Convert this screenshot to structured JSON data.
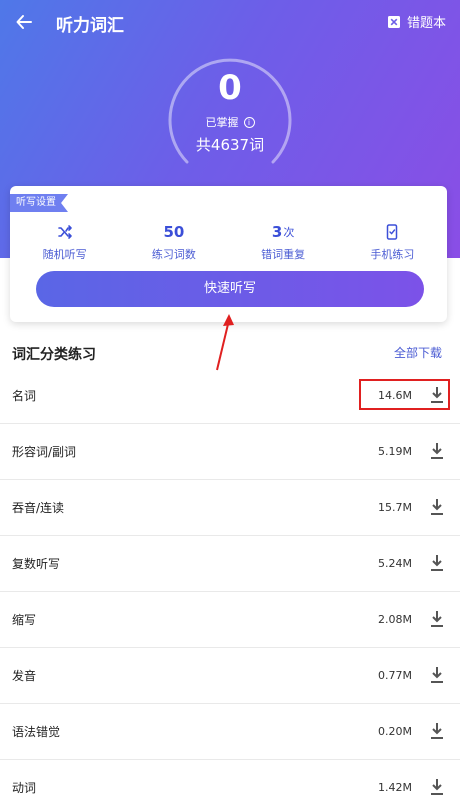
{
  "header": {
    "title": "听力词汇",
    "mistake_book_label": "错题本",
    "mastered_count": "0",
    "mastered_label": "已掌握",
    "total_label": "共4637词"
  },
  "settings_card": {
    "tag": "听写设置",
    "items": [
      {
        "value": "",
        "unit": "",
        "icon": "shuffle-icon",
        "label": "随机听写"
      },
      {
        "value": "50",
        "unit": "",
        "icon": "",
        "label": "练习词数"
      },
      {
        "value": "3",
        "unit": "次",
        "icon": "",
        "label": "错词重复"
      },
      {
        "value": "",
        "unit": "",
        "icon": "phone-icon",
        "label": "手机练习"
      }
    ],
    "quick_button": "快速听写"
  },
  "list": {
    "title": "词汇分类练习",
    "download_all": "全部下载",
    "rows": [
      {
        "name": "名词",
        "size": "14.6M"
      },
      {
        "name": "形容词/副词",
        "size": "5.19M"
      },
      {
        "name": "吞音/连读",
        "size": "15.7M"
      },
      {
        "name": "复数听写",
        "size": "5.24M"
      },
      {
        "name": "缩写",
        "size": "2.08M"
      },
      {
        "name": "发音",
        "size": "0.77M"
      },
      {
        "name": "语法错觉",
        "size": "0.20M"
      },
      {
        "name": "动词",
        "size": "1.42M"
      }
    ]
  },
  "colors": {
    "accent": "#4a5bd3",
    "gradient_start": "#4f78e8",
    "gradient_end": "#8a4ee6",
    "annotation": "#e02020"
  }
}
